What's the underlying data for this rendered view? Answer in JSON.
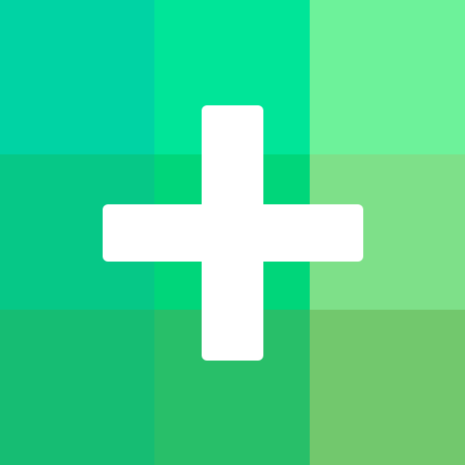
{
  "icon": {
    "name": "add-icon",
    "symbol": "plus",
    "glyph_color": "#ffffff"
  },
  "tiles": [
    {
      "id": "r0c0",
      "color": "#00d3a4"
    },
    {
      "id": "r0c1",
      "color": "#00e598"
    },
    {
      "id": "r0c2",
      "color": "#6df29a"
    },
    {
      "id": "r1c0",
      "color": "#06c887"
    },
    {
      "id": "r1c1",
      "color": "#00d67a"
    },
    {
      "id": "r1c2",
      "color": "#7ee089"
    },
    {
      "id": "r2c0",
      "color": "#16bd73"
    },
    {
      "id": "r2c1",
      "color": "#28bf69"
    },
    {
      "id": "r2c2",
      "color": "#72c86d"
    }
  ]
}
